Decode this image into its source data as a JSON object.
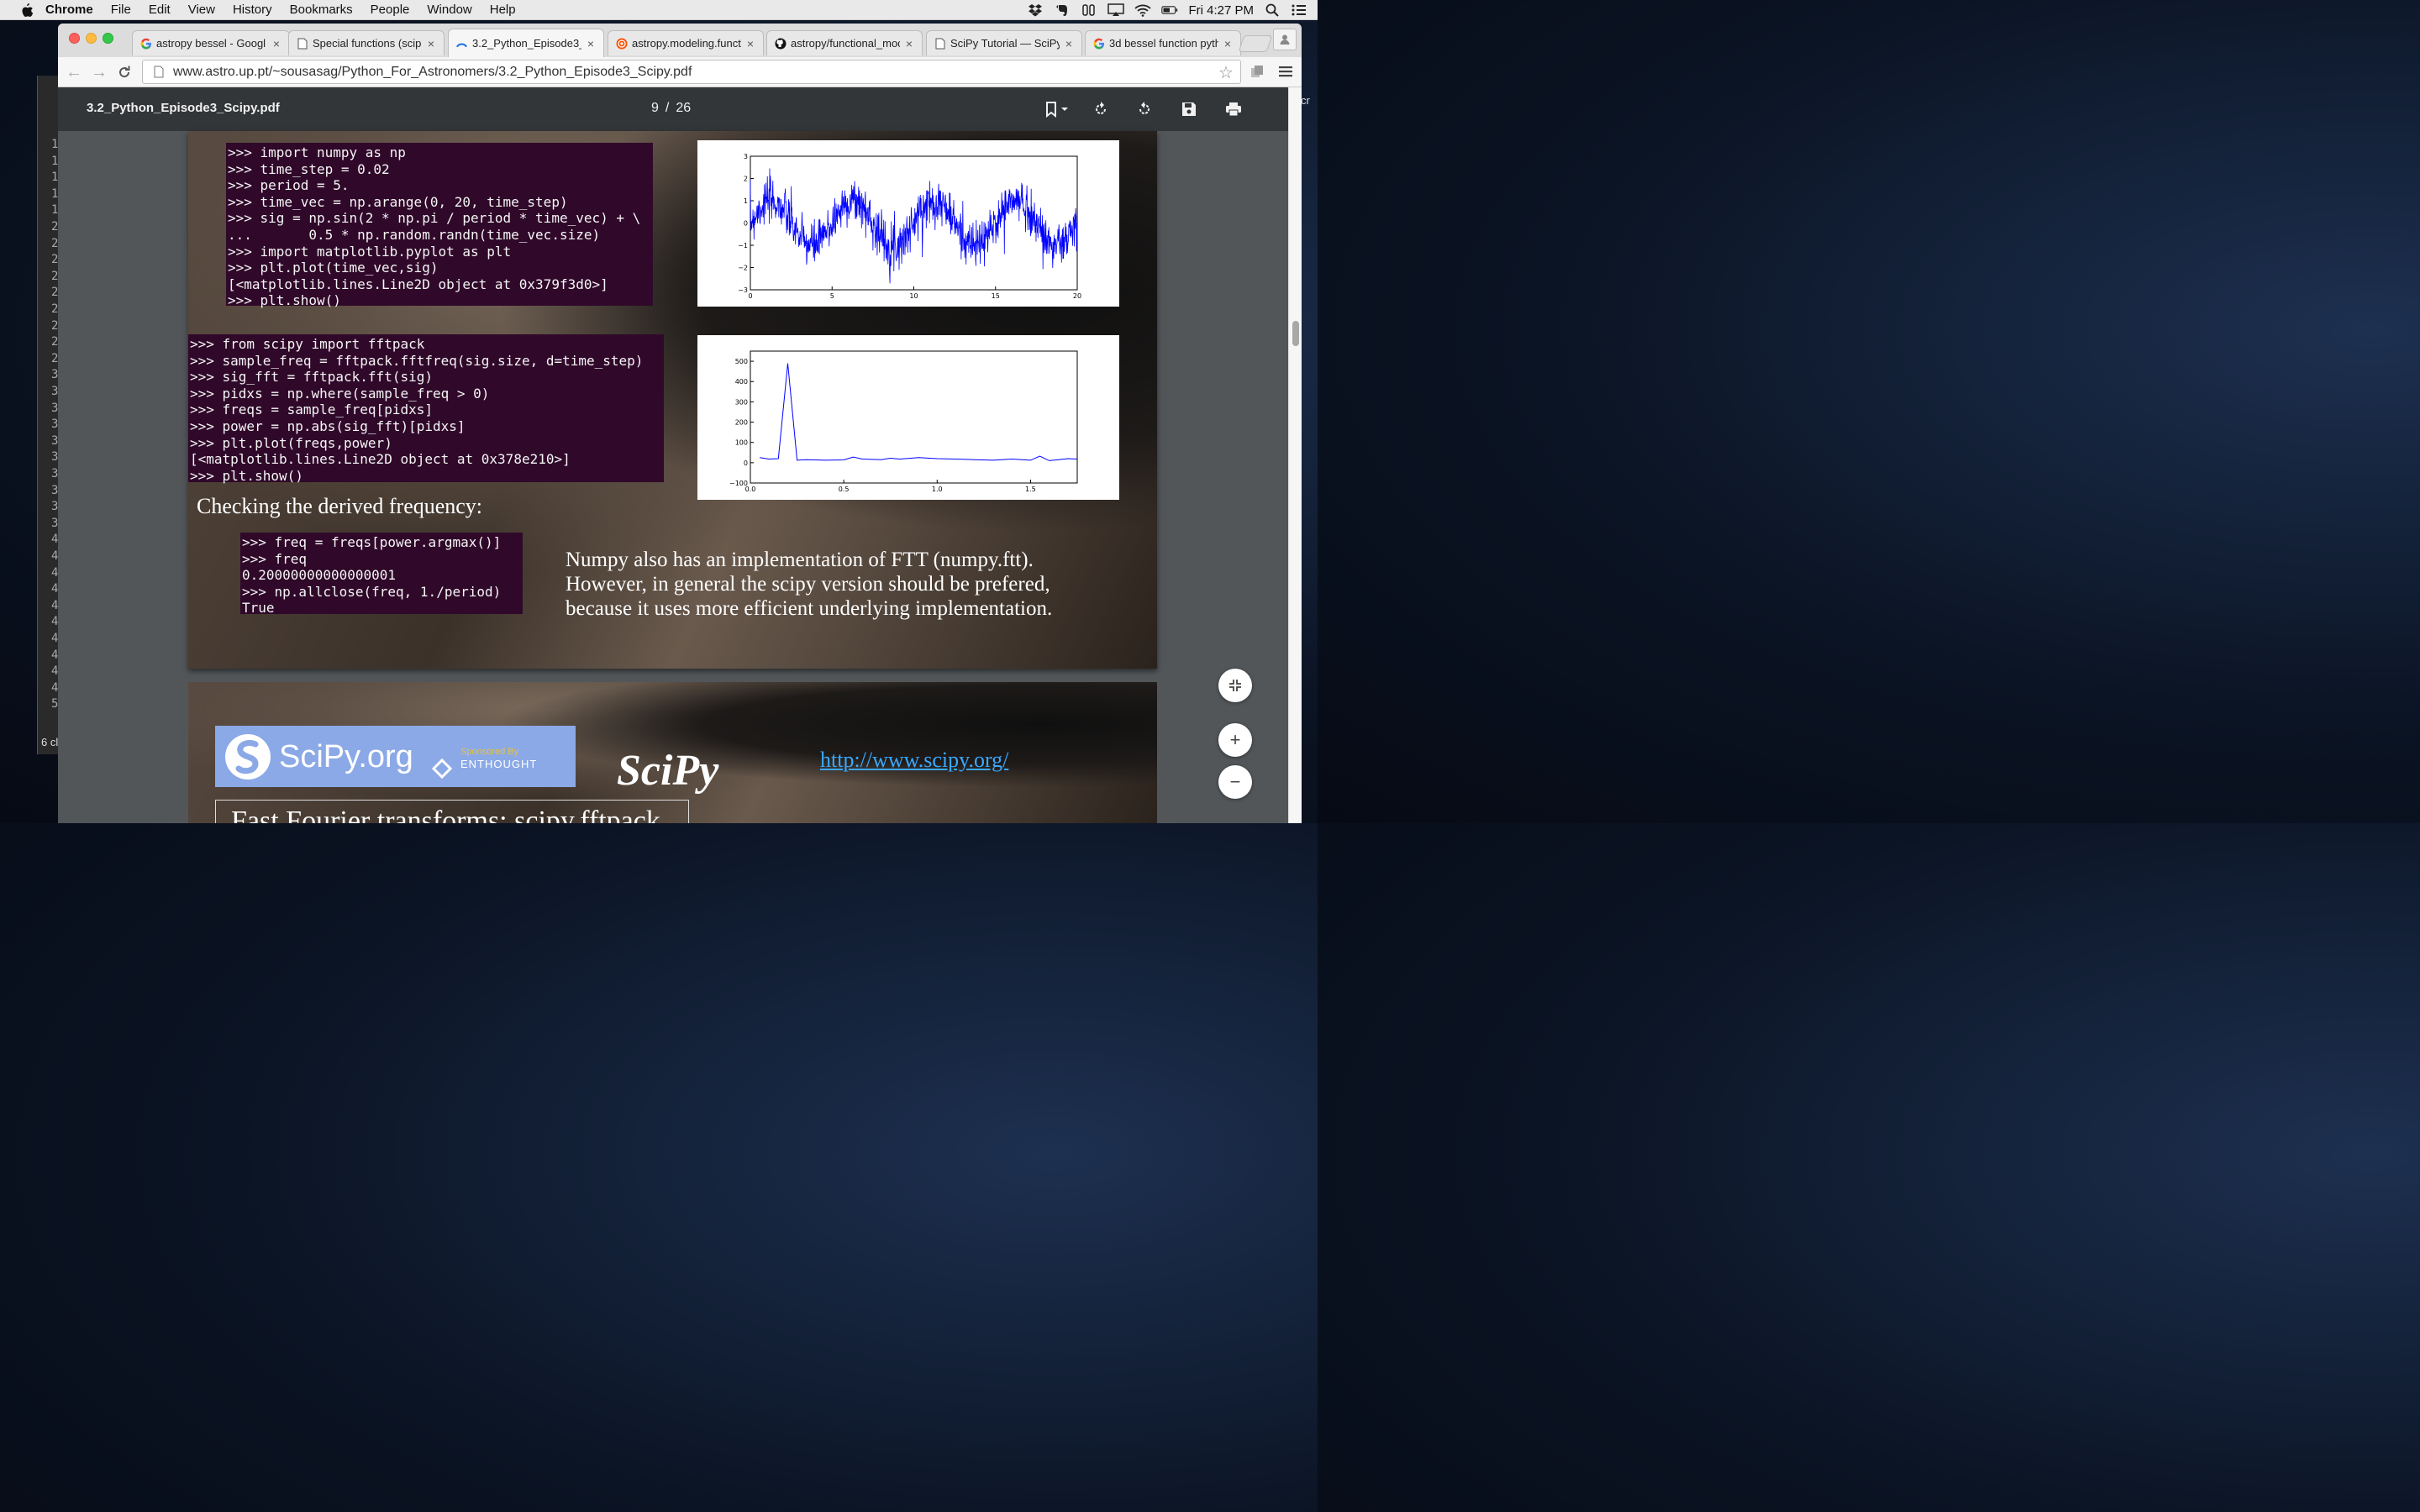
{
  "menubar": {
    "app_name": "Chrome",
    "menus": [
      "File",
      "Edit",
      "View",
      "History",
      "Bookmarks",
      "People",
      "Window",
      "Help"
    ],
    "clock": "Fri 4:27 PM",
    "status_icons": [
      "dropbox-icon",
      "evernote-icon",
      "sidebar-icon",
      "airplay-icon",
      "wifi-icon",
      "battery-icon",
      "spotlight-icon",
      "notification-center-icon"
    ]
  },
  "background_window": {
    "line_numbers": [
      "1",
      "1",
      "1",
      "1",
      "1",
      "2",
      "2",
      "2",
      "2",
      "2",
      "2",
      "2",
      "2",
      "2",
      "3",
      "3",
      "3",
      "3",
      "3",
      "3",
      "3",
      "3",
      "3",
      "3",
      "4",
      "4",
      "4",
      "4",
      "4",
      "4",
      "4",
      "4",
      "4",
      "4",
      "5"
    ],
    "footer_text": "6 cl",
    "right_text": "cr"
  },
  "tabs": [
    {
      "title": "astropy bessel - Googl",
      "icon": "google-icon",
      "active": false
    },
    {
      "title": "Special functions (scip",
      "icon": "page-icon",
      "active": false
    },
    {
      "title": "3.2_Python_Episode3_",
      "icon": "loading-icon",
      "active": true
    },
    {
      "title": "astropy.modeling.funct",
      "icon": "astropy-icon",
      "active": false
    },
    {
      "title": "astropy/functional_moc",
      "icon": "github-icon",
      "active": false
    },
    {
      "title": "SciPy Tutorial — SciPy",
      "icon": "page-icon",
      "active": false
    },
    {
      "title": "3d bessel function pyth",
      "icon": "google-icon",
      "active": false
    }
  ],
  "address_bar": {
    "url": "www.astro.up.pt/~sousasag/Python_For_Astronomers/3.2_Python_Episode3_Scipy.pdf"
  },
  "pdf_toolbar": {
    "filename": "3.2_Python_Episode3_Scipy.pdf",
    "current_page": "9",
    "separator": "/",
    "total_pages": "26"
  },
  "slide1": {
    "code_block_1": ">>> import numpy as np\n>>> time_step = 0.02\n>>> period = 5.\n>>> time_vec = np.arange(0, 20, time_step)\n>>> sig = np.sin(2 * np.pi / period * time_vec) + \\\n...       0.5 * np.random.randn(time_vec.size)\n>>> import matplotlib.pyplot as plt\n>>> plt.plot(time_vec,sig)\n[<matplotlib.lines.Line2D object at 0x379f3d0>]\n>>> plt.show()",
    "code_block_2": ">>> from scipy import fftpack\n>>> sample_freq = fftpack.fftfreq(sig.size, d=time_step)\n>>> sig_fft = fftpack.fft(sig)\n>>> pidxs = np.where(sample_freq > 0)\n>>> freqs = sample_freq[pidxs]\n>>> power = np.abs(sig_fft)[pidxs]\n>>> plt.plot(freqs,power)\n[<matplotlib.lines.Line2D object at 0x378e210>]\n>>> plt.show()",
    "checking_text": "Checking the derived frequency:",
    "code_block_3": ">>> freq = freqs[power.argmax()]\n>>> freq\n0.20000000000000001\n>>> np.allclose(freq, 1./period)\nTrue",
    "note_line_1": "Numpy also has an implementation of FTT (numpy.ftt).",
    "note_line_2": "However, in general the scipy version should be prefered,",
    "note_line_3": "because it uses more efficient underlying implementation."
  },
  "slide2": {
    "logo_text": "SciPy.org",
    "sponsor_small": "Sponsored By",
    "sponsor_name": "ENTHOUGHT",
    "scipy_title": "SciPy",
    "link": "http://www.scipy.org/",
    "heading": "Fast Fourier transforms: scipy.fftpack"
  },
  "zoom_controls": {
    "fit": "fit-page-icon",
    "zoom_in": "+",
    "zoom_out": "−"
  },
  "colors": {
    "terminal_bg": "#30092a",
    "plot_line": "#0000ff",
    "link": "#3aa8ff",
    "pdf_toolbar": "#323639"
  },
  "chart_data": [
    {
      "type": "line",
      "title": "",
      "xlabel": "",
      "ylabel": "",
      "xlim": [
        0,
        20
      ],
      "ylim": [
        -3,
        3
      ],
      "xticks": [
        0,
        5,
        10,
        15,
        20
      ],
      "yticks": [
        -3,
        -2,
        -1,
        0,
        1,
        2,
        3
      ],
      "x_tick_labels": [
        "0",
        "5",
        "10",
        "15",
        "20"
      ],
      "y_tick_labels": [
        "−3",
        "−2",
        "−1",
        "0",
        "1",
        "2",
        "3"
      ],
      "series": [
        {
          "description_x": "time_vec from 0 to 20 step 0.02",
          "x_start": 0,
          "x_end": 20,
          "x_step": 0.02,
          "underlying": "sin(2*pi/5*t) plus noise (std 0.5)",
          "sample_points_x": [
            0,
            1.25,
            2.5,
            3.75,
            5,
            6.25,
            7.5,
            8.75,
            10,
            11.25,
            12.5,
            13.75,
            15,
            16.25,
            17.5,
            18.75,
            20
          ],
          "sample_points_y": [
            0,
            1,
            0,
            -1,
            0,
            1,
            0,
            -1,
            0,
            1,
            0,
            -1,
            0,
            1,
            0,
            -1,
            0
          ]
        }
      ],
      "grid": false
    },
    {
      "type": "line",
      "title": "",
      "xlabel": "",
      "ylabel": "",
      "xlim": [
        0,
        1.75
      ],
      "ylim": [
        -100,
        550
      ],
      "xticks": [
        0.0,
        0.5,
        1.0,
        1.5
      ],
      "yticks": [
        -100,
        0,
        100,
        200,
        300,
        400,
        500
      ],
      "x_tick_labels": [
        "0.0",
        "0.5",
        "1.0",
        "1.5"
      ],
      "y_tick_labels": [
        "−100",
        "0",
        "100",
        "200",
        "300",
        "400",
        "500"
      ],
      "x": [
        0.05,
        0.1,
        0.15,
        0.2,
        0.25,
        0.3,
        0.4,
        0.5,
        0.55,
        0.6,
        0.7,
        0.75,
        0.8,
        0.9,
        1.0,
        1.1,
        1.2,
        1.3,
        1.4,
        1.5,
        1.55,
        1.6,
        1.65,
        1.7,
        1.75
      ],
      "y": [
        25,
        18,
        20,
        490,
        12,
        15,
        12,
        14,
        28,
        18,
        15,
        22,
        18,
        25,
        20,
        18,
        15,
        12,
        18,
        12,
        32,
        10,
        15,
        20,
        18
      ],
      "grid": false
    }
  ]
}
